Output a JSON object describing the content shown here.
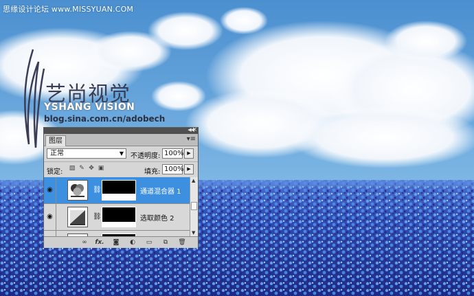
{
  "site_watermark": "思缘设计论坛 www.MISSYUAN.COM",
  "logo": {
    "cn": "艺尚视觉",
    "en": "YSHANG VISION",
    "url": "blog.sina.com.cn/adobech"
  },
  "panel": {
    "tab": "图层",
    "blend_mode": "正常",
    "opacity_label": "不透明度:",
    "opacity_value": "100%",
    "lock_label": "锁定:",
    "fill_label": "填充:",
    "fill_value": "100%",
    "layers": [
      {
        "name": "通道混合器 1",
        "selected": true,
        "icon": "channel-mixer-icon"
      },
      {
        "name": "选取颜色 2",
        "selected": false,
        "icon": "selective-color-icon"
      },
      {
        "name": "",
        "selected": false,
        "icon": "curves-icon"
      }
    ],
    "colors": {
      "selected": "#3d8fe0",
      "panel": "#d6d6d6"
    }
  }
}
